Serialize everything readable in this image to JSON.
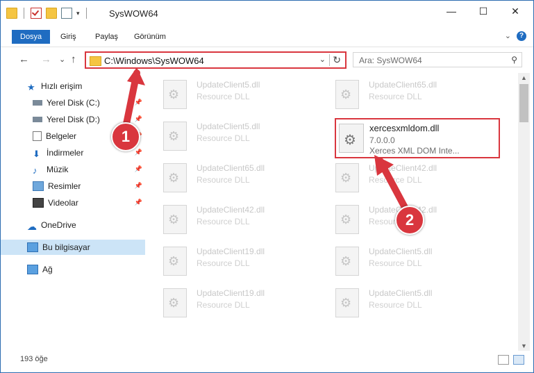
{
  "title_bar": {
    "title": "SysWOW64",
    "minimize": "—",
    "maximize": "☐",
    "close": "✕"
  },
  "ribbon": {
    "tabs": [
      "Dosya",
      "Giriş",
      "Paylaş",
      "Görünüm"
    ],
    "help": "?"
  },
  "navigation": {
    "back": "←",
    "forward": "→",
    "recent": "⌄",
    "up": "↑",
    "address": "C:\\Windows\\SysWOW64",
    "search_placeholder": "Ara: SysWOW64"
  },
  "sidebar": {
    "items": [
      {
        "label": "Hızlı erişim",
        "icon": "star-icon"
      },
      {
        "label": "Yerel Disk (C:)",
        "icon": "drive-icon",
        "pinned": true
      },
      {
        "label": "Yerel Disk (D:)",
        "icon": "drive-icon",
        "pinned": true
      },
      {
        "label": "Belgeler",
        "icon": "documents-icon",
        "pinned": true
      },
      {
        "label": "İndirmeler",
        "icon": "download-icon",
        "pinned": true
      },
      {
        "label": "Müzik",
        "icon": "music-icon",
        "pinned": true
      },
      {
        "label": "Resimler",
        "icon": "pictures-icon",
        "pinned": true
      },
      {
        "label": "Videolar",
        "icon": "videos-icon",
        "pinned": true
      },
      {
        "label": "OneDrive",
        "icon": "cloud-icon"
      },
      {
        "label": "Bu bilgisayar",
        "icon": "computer-icon",
        "selected": true
      },
      {
        "label": "Ağ",
        "icon": "network-icon"
      }
    ]
  },
  "files": [
    {
      "name": "UpdateClient5.dll",
      "type": "Resource DLL"
    },
    {
      "name": "UpdateClient65.dll",
      "type": "Resource DLL"
    },
    {
      "name": "UpdateClient5.dll",
      "type": "Resource DLL"
    },
    {
      "name": "UpdateClient65.dll",
      "type": "Resource DLL"
    },
    {
      "name": "UpdateClient42.dll",
      "type": "Resource DLL"
    },
    {
      "name": "UpdateClient42.dll",
      "type": "Resource DLL"
    },
    {
      "name": "UpdateClient42.dll",
      "type": "Resource DLL"
    },
    {
      "name": "UpdateClient19.dll",
      "type": "Resource DLL"
    },
    {
      "name": "UpdateClient5.dll",
      "type": "Resource DLL"
    },
    {
      "name": "UpdateClient19.dll",
      "type": "Resource DLL"
    },
    {
      "name": "UpdateClient5.dll",
      "type": "Resource DLL"
    }
  ],
  "highlighted_file": {
    "name": "xercesxmldom.dll",
    "version": "7.0.0.0",
    "description": "Xerces XML DOM Inte..."
  },
  "status": {
    "count": "193 öğe"
  },
  "annotations": {
    "marker1": "1",
    "marker2": "2",
    "color": "#d9363e"
  }
}
